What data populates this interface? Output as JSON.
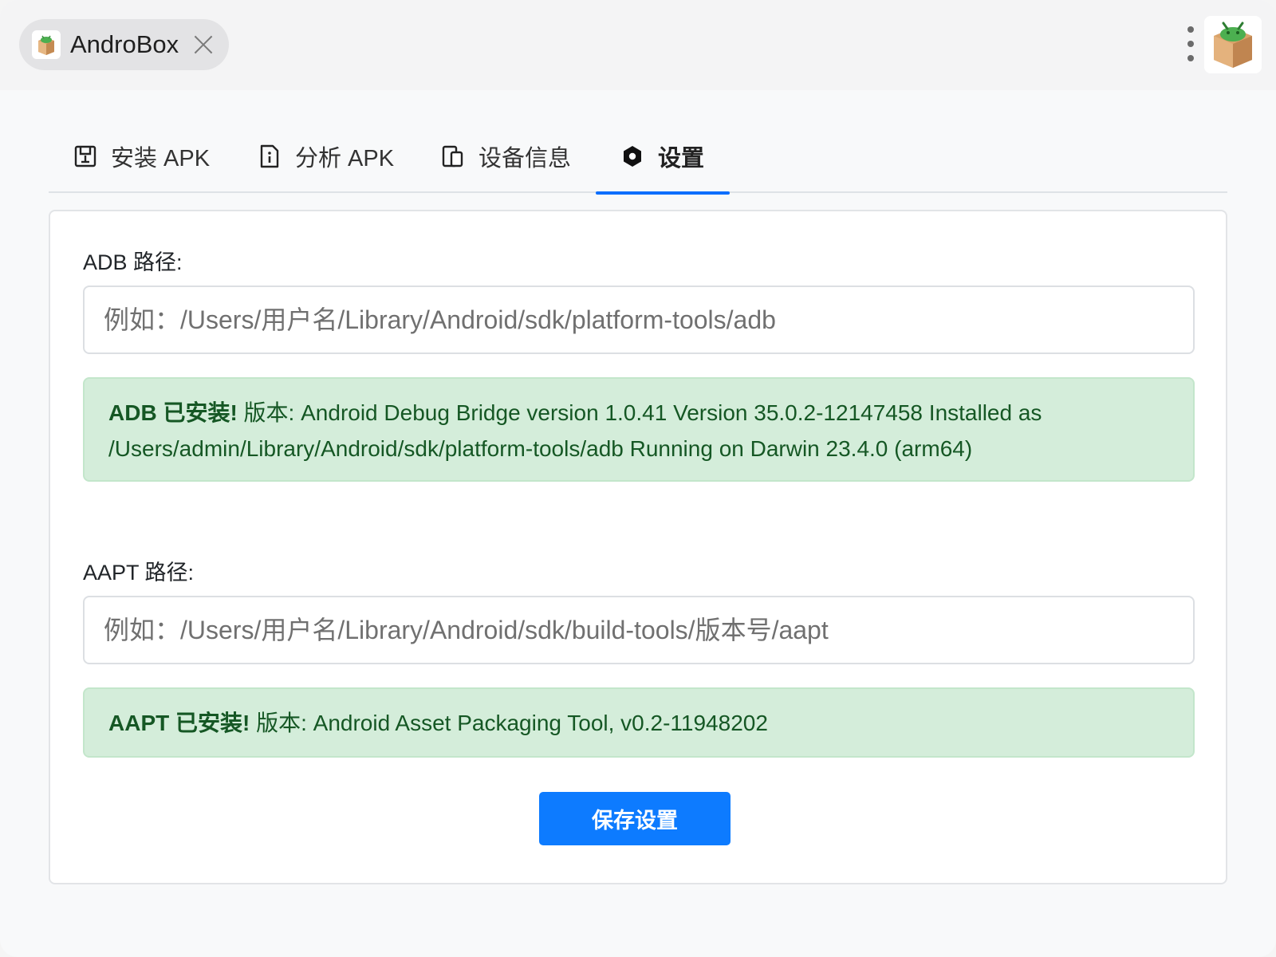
{
  "window": {
    "tab_title": "AndroBox"
  },
  "nav": {
    "tabs": [
      {
        "label": "安装 APK",
        "icon": "save-icon"
      },
      {
        "label": "分析 APK",
        "icon": "file-info-icon"
      },
      {
        "label": "设备信息",
        "icon": "devices-icon"
      },
      {
        "label": "设置",
        "icon": "gear-icon",
        "active": true
      }
    ]
  },
  "settings": {
    "adb": {
      "label": "ADB 路径:",
      "value": "",
      "placeholder": "例如：/Users/用户名/Library/Android/sdk/platform-tools/adb",
      "status_strong": "ADB 已安装!",
      "status_text": " 版本: Android Debug Bridge version 1.0.41 Version 35.0.2-12147458 Installed as /Users/admin/Library/Android/sdk/platform-tools/adb Running on Darwin 23.4.0 (arm64)"
    },
    "aapt": {
      "label": "AAPT 路径:",
      "value": "",
      "placeholder": "例如：/Users/用户名/Library/Android/sdk/build-tools/版本号/aapt",
      "status_strong": "AAPT 已安装!",
      "status_text": " 版本: Android Asset Packaging Tool, v0.2-11948202"
    },
    "save_label": "保存设置"
  },
  "colors": {
    "accent": "#0d6efd",
    "button": "#0d7bff",
    "success_bg": "#d4edda",
    "success_text": "#155724"
  }
}
